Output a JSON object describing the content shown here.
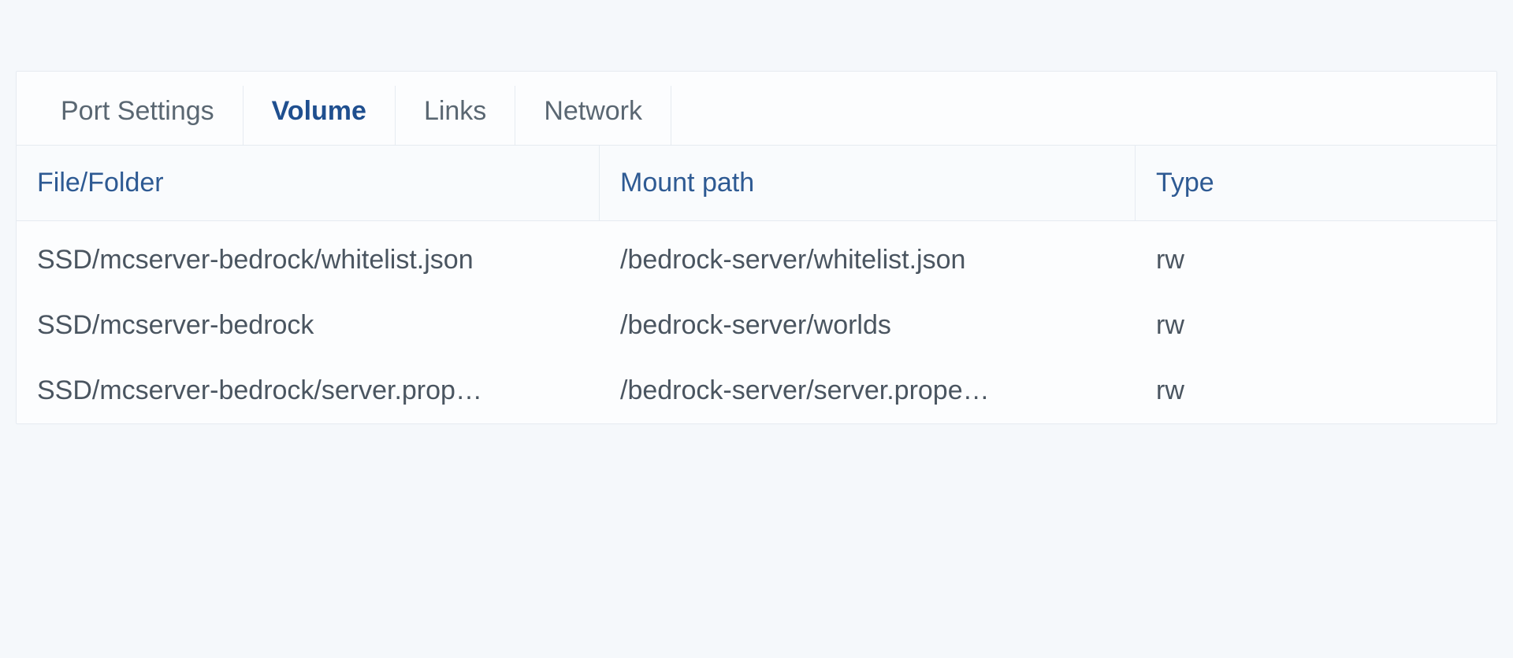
{
  "tabs": {
    "port_settings": "Port Settings",
    "volume": "Volume",
    "links": "Links",
    "network": "Network",
    "active": "volume"
  },
  "table": {
    "headers": {
      "file_folder": "File/Folder",
      "mount_path": "Mount path",
      "type": "Type"
    },
    "rows": [
      {
        "file_folder": "SSD/mcserver-bedrock/whitelist.json",
        "mount_path": "/bedrock-server/whitelist.json",
        "type": "rw"
      },
      {
        "file_folder": "SSD/mcserver-bedrock",
        "mount_path": "/bedrock-server/worlds",
        "type": "rw"
      },
      {
        "file_folder": "SSD/mcserver-bedrock/server.prop…",
        "mount_path": "/bedrock-server/server.prope…",
        "type": "rw"
      }
    ]
  }
}
